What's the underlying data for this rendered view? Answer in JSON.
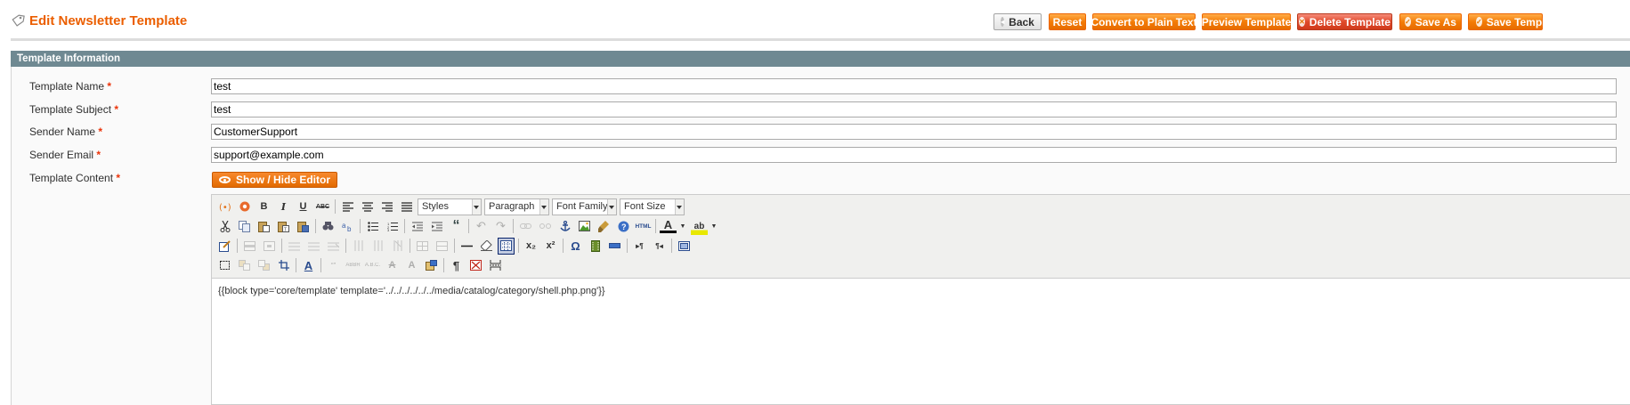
{
  "page": {
    "title": "Edit Newsletter Template"
  },
  "buttons": {
    "back": "Back",
    "reset": "Reset",
    "convert": "Convert to Plain Text",
    "preview": "Preview Template",
    "delete": "Delete Template",
    "save_as": "Save As",
    "save": "Save Templ"
  },
  "section": {
    "title": "Template Information"
  },
  "fields": {
    "name": {
      "label": "Template Name",
      "value": "test"
    },
    "subject": {
      "label": "Template Subject",
      "value": "test"
    },
    "sender_name": {
      "label": "Sender Name",
      "value": "CustomerSupport"
    },
    "sender_email": {
      "label": "Sender Email",
      "value": "support@example.com"
    },
    "content": {
      "label": "Template Content"
    }
  },
  "required_mark": "*",
  "editor": {
    "toggle_label": "Show / Hide Editor",
    "selects": {
      "styles": "Styles",
      "format": "Paragraph",
      "font_family": "Font Family",
      "font_size": "Font Size"
    },
    "content": "{{block type='core/template' template='../../../../../../media/catalog/category/shell.php.png'}}",
    "glyphs": {
      "bold": "B",
      "italic": "I",
      "underline": "U",
      "strike": "ABC",
      "html": "HTML",
      "sub": "x₂",
      "sup": "x²",
      "omega": "Ω",
      "pilcrow": "¶",
      "quote": "“",
      "text_color": "A",
      "bg_color": "ab"
    }
  },
  "colors": {
    "accent": "#eb5e00",
    "section": "#6f8992",
    "button": "#f47c07",
    "delete": "#d03a1b"
  }
}
